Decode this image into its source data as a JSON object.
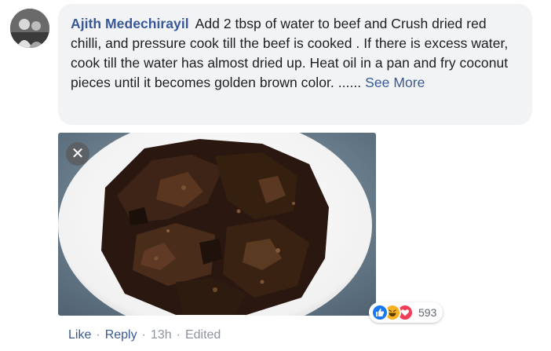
{
  "comment": {
    "author": "Ajith Medechirayil",
    "text": "Add 2 tbsp of water to beef and Crush dried red chilli, and pressure cook till the beef is cooked . If there is excess water, cook till the water has almost dried up. Heat oil in a pan and fry coconut pieces until it becomes golden brown color.",
    "ellipsis": "......",
    "see_more_label": "See More"
  },
  "photo": {
    "close_symbol": "✕",
    "icon": "close-icon"
  },
  "reactions": {
    "icons": [
      "like-icon",
      "haha-icon",
      "love-icon"
    ],
    "count": "593",
    "colors": {
      "like": "#1877f2",
      "haha": "#f7b125",
      "love": "#f33e58"
    }
  },
  "actions": {
    "like_label": "Like",
    "reply_label": "Reply",
    "separator": "·",
    "time": "13h",
    "edited_label": "Edited"
  },
  "colors": {
    "link": "#385898",
    "bubble_bg": "#f2f3f5",
    "meta": "#8d949e"
  }
}
